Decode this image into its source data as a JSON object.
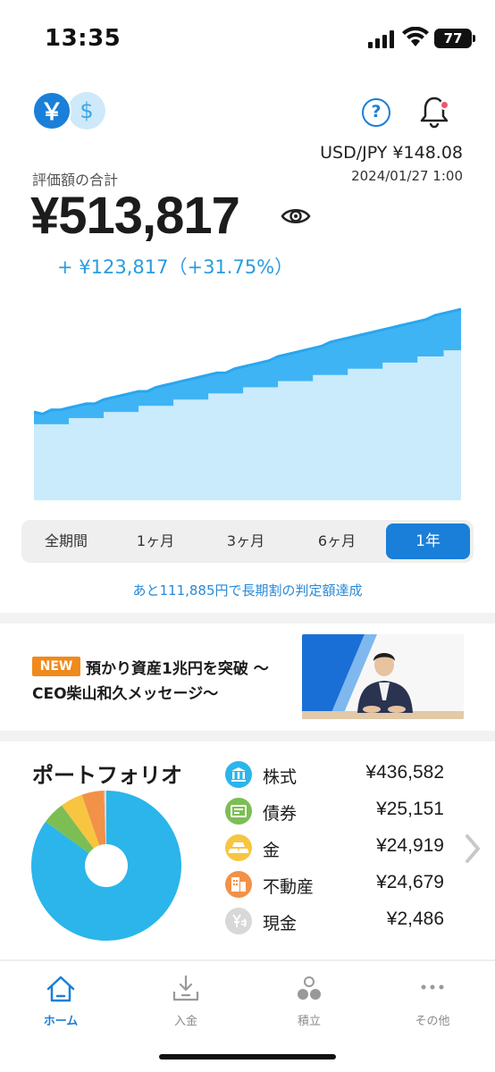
{
  "status_bar": {
    "time": "13:35",
    "battery": "77"
  },
  "header": {
    "currency_jpy": "￥",
    "currency_usd": "$",
    "help_label": "?",
    "fx_rate": "USD/JPY  ¥148.08",
    "fx_date": "2024/01/27 1:00",
    "has_notification": true
  },
  "valuation": {
    "label": "評価額の合計",
    "total": "¥513,817",
    "gain": "+ ¥123,817（+31.75%）"
  },
  "chart_data": {
    "type": "area",
    "title": "",
    "series": [
      {
        "values": [
          0.43,
          0.42,
          0.44,
          0.44,
          0.45,
          0.46,
          0.47,
          0.47,
          0.49,
          0.5,
          0.51,
          0.52,
          0.53,
          0.53,
          0.55,
          0.56,
          0.57,
          0.58,
          0.59,
          0.6,
          0.61,
          0.62,
          0.62,
          0.64,
          0.65,
          0.66,
          0.67,
          0.68,
          0.7,
          0.71,
          0.72,
          0.73,
          0.74,
          0.75,
          0.77,
          0.78,
          0.79,
          0.8,
          0.81,
          0.82,
          0.83,
          0.84,
          0.85,
          0.86,
          0.87,
          0.88,
          0.9,
          0.91,
          0.92,
          0.93
        ]
      },
      {
        "values": [
          0.37,
          0.37,
          0.37,
          0.37,
          0.4,
          0.4,
          0.4,
          0.4,
          0.43,
          0.43,
          0.43,
          0.43,
          0.46,
          0.46,
          0.46,
          0.46,
          0.49,
          0.49,
          0.49,
          0.49,
          0.52,
          0.52,
          0.52,
          0.52,
          0.55,
          0.55,
          0.55,
          0.55,
          0.58,
          0.58,
          0.58,
          0.58,
          0.61,
          0.61,
          0.61,
          0.61,
          0.64,
          0.64,
          0.64,
          0.64,
          0.67,
          0.67,
          0.67,
          0.67,
          0.7,
          0.7,
          0.7,
          0.73,
          0.73,
          0.73
        ]
      }
    ],
    "ylim": [
      0,
      1
    ],
    "colors": {
      "value": "#3fb4f4",
      "principal": "#c9ebfc"
    },
    "grid": false
  },
  "period_tabs": {
    "items": [
      {
        "label": "全期間"
      },
      {
        "label": "1ヶ月"
      },
      {
        "label": "3ヶ月"
      },
      {
        "label": "6ヶ月"
      },
      {
        "label": "1年"
      }
    ],
    "selected": "1年"
  },
  "goal_message": "あと111,885円で長期割の判定額達成",
  "banner": {
    "badge": "NEW",
    "line1": "預かり資産1兆円を突破 〜",
    "line2": "CEO柴山和久メッセージ〜"
  },
  "portfolio": {
    "title": "ポートフォリオ",
    "items": [
      {
        "label": "株式",
        "value": "¥436,582",
        "amount": 436582,
        "color": "#2bb5ea",
        "icon": "bank-building-icon"
      },
      {
        "label": "債券",
        "value": "¥25,151",
        "amount": 25151,
        "color": "#7cbe54",
        "icon": "bond-certificate-icon"
      },
      {
        "label": "金",
        "value": "¥24,919",
        "amount": 24919,
        "color": "#f7c540",
        "icon": "gold-bars-icon"
      },
      {
        "label": "不動産",
        "value": "¥24,679",
        "amount": 24679,
        "color": "#f29148",
        "icon": "real-estate-icon"
      },
      {
        "label": "現金",
        "value": "¥2,486",
        "amount": 2486,
        "color": "#d8d8d8",
        "icon": "cash-yen-icon"
      }
    ]
  },
  "bottom_nav": {
    "items": [
      {
        "label": "ホーム",
        "icon": "home-icon"
      },
      {
        "label": "入金",
        "icon": "deposit-icon"
      },
      {
        "label": "積立",
        "icon": "accumulate-icon"
      },
      {
        "label": "その他",
        "icon": "more-icon"
      }
    ],
    "selected": "ホーム"
  }
}
